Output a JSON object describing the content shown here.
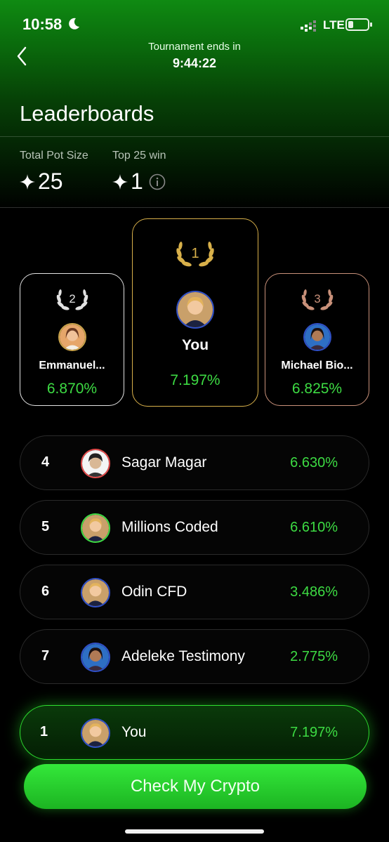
{
  "status_bar": {
    "time": "10:58",
    "network": "LTE"
  },
  "header": {
    "tournament_label": "Tournament ends in",
    "tournament_timer": "9:44:22",
    "title": "Leaderboards"
  },
  "stats": {
    "pot_label": "Total Pot Size",
    "pot_value": "25",
    "top_label": "Top 25 win",
    "top_value": "1"
  },
  "podium": [
    {
      "rank": "1",
      "name": "You",
      "pct": "7.197%",
      "color": "#d8b04a"
    },
    {
      "rank": "2",
      "name": "Emmanuel...",
      "pct": "6.870%",
      "color": "#e2e2e2"
    },
    {
      "rank": "3",
      "name": "Michael Bio...",
      "pct": "6.825%",
      "color": "#c9917a"
    }
  ],
  "rows": [
    {
      "rank": "4",
      "name": "Sagar Magar",
      "pct": "6.630%"
    },
    {
      "rank": "5",
      "name": "Millions Coded",
      "pct": "6.610%"
    },
    {
      "rank": "6",
      "name": "Odin CFD",
      "pct": "3.486%"
    },
    {
      "rank": "7",
      "name": "Adeleke Testimony",
      "pct": "2.775%"
    }
  ],
  "me_row": {
    "rank": "1",
    "name": "You",
    "pct": "7.197%"
  },
  "cta": {
    "label": "Check My Crypto"
  },
  "colors": {
    "accent": "#3ddb43",
    "gold": "#d8b04a",
    "silver": "#e2e2e2",
    "bronze": "#c9917a"
  }
}
